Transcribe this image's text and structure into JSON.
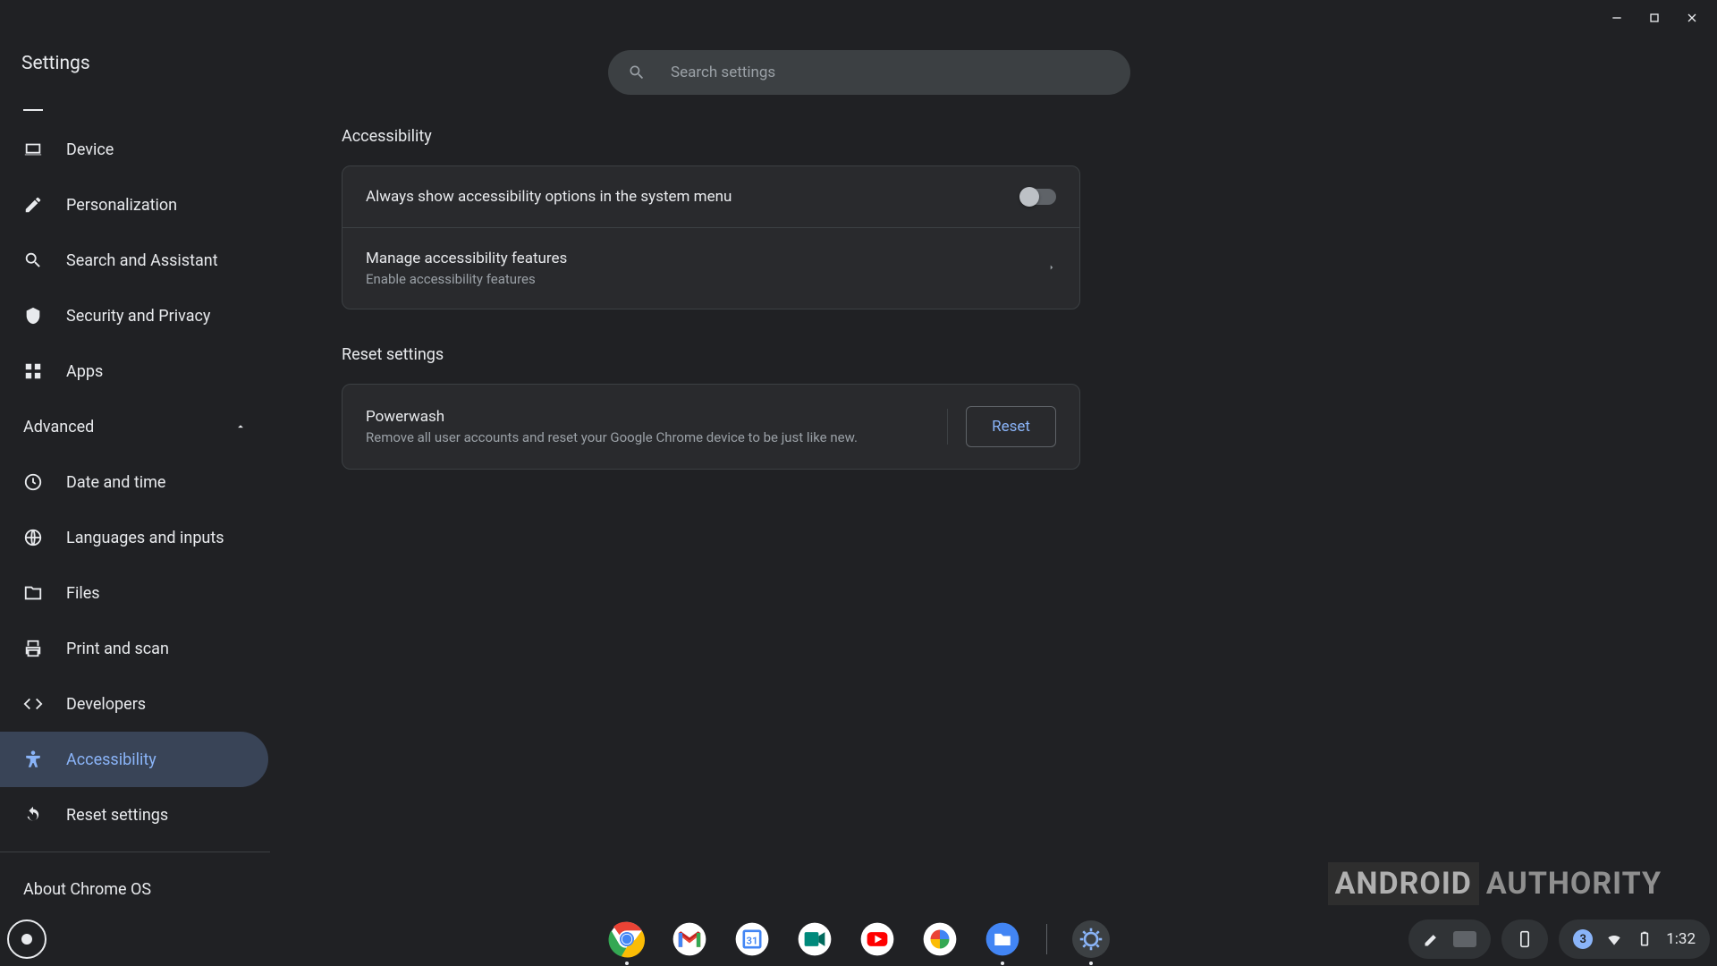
{
  "window": {
    "title": "Settings"
  },
  "search": {
    "placeholder": "Search settings"
  },
  "sidebar": {
    "items": [
      {
        "id": "device",
        "label": "Device"
      },
      {
        "id": "personalization",
        "label": "Personalization"
      },
      {
        "id": "search-assistant",
        "label": "Search and Assistant"
      },
      {
        "id": "security-privacy",
        "label": "Security and Privacy"
      },
      {
        "id": "apps",
        "label": "Apps"
      }
    ],
    "advanced_label": "Advanced",
    "advanced_expanded": true,
    "advanced_items": [
      {
        "id": "date-time",
        "label": "Date and time"
      },
      {
        "id": "languages-inputs",
        "label": "Languages and inputs"
      },
      {
        "id": "files",
        "label": "Files"
      },
      {
        "id": "print-scan",
        "label": "Print and scan"
      },
      {
        "id": "developers",
        "label": "Developers"
      },
      {
        "id": "accessibility",
        "label": "Accessibility",
        "active": true
      },
      {
        "id": "reset-settings",
        "label": "Reset settings"
      }
    ],
    "about_label": "About Chrome OS"
  },
  "main": {
    "accessibility": {
      "title": "Accessibility",
      "always_show_label": "Always show accessibility options in the system menu",
      "always_show_enabled": false,
      "manage_title": "Manage accessibility features",
      "manage_subtitle": "Enable accessibility features"
    },
    "reset": {
      "title": "Reset settings",
      "powerwash_title": "Powerwash",
      "powerwash_subtitle": "Remove all user accounts and reset your Google Chrome device to be just like new.",
      "button_label": "Reset"
    }
  },
  "shelf": {
    "apps": [
      {
        "id": "chrome",
        "name": "Chrome",
        "running": true
      },
      {
        "id": "gmail",
        "name": "Gmail"
      },
      {
        "id": "calendar",
        "name": "Calendar"
      },
      {
        "id": "meet",
        "name": "Meet"
      },
      {
        "id": "youtube",
        "name": "YouTube"
      },
      {
        "id": "photos",
        "name": "Photos"
      },
      {
        "id": "files",
        "name": "Files",
        "running": true
      },
      {
        "id": "settings",
        "name": "Settings",
        "running": true,
        "active": true
      }
    ],
    "tray": {
      "badge_count": "3",
      "time": "1:32"
    }
  },
  "watermark": {
    "a": "ANDROID",
    "b": "AUTHORITY"
  }
}
